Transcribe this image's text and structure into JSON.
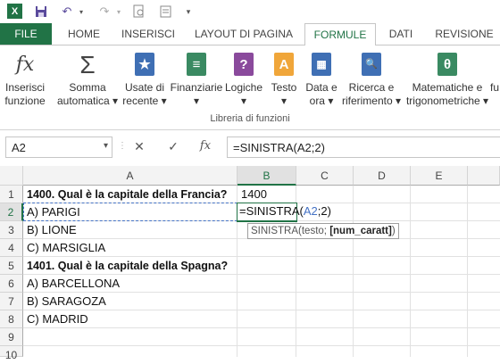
{
  "qat": {
    "app_icon": "X",
    "save_icon": "save-icon",
    "undo_icon": "undo-icon",
    "redo_icon": "redo-icon"
  },
  "tabs": [
    {
      "label": "FILE"
    },
    {
      "label": "HOME"
    },
    {
      "label": "INSERISCI"
    },
    {
      "label": "LAYOUT DI PAGINA"
    },
    {
      "label": "FORMULE"
    },
    {
      "label": "DATI"
    },
    {
      "label": "REVISIONE"
    }
  ],
  "ribbon": {
    "buttons": [
      {
        "label": "Inserisci\nfunzione",
        "line1": "Inserisci",
        "line2": "funzione",
        "icon": "fx"
      },
      {
        "line1": "Somma",
        "line2": "automatica ▾",
        "icon": "Σ"
      },
      {
        "line1": "Usate di",
        "line2": "recente ▾",
        "icon": "★"
      },
      {
        "line1": "Finanziarie",
        "line2": "▾",
        "icon": "≡"
      },
      {
        "line1": "Logiche",
        "line2": "▾",
        "icon": "?"
      },
      {
        "line1": "Testo",
        "line2": "▾",
        "icon": "A"
      },
      {
        "line1": "Data e",
        "line2": "ora ▾",
        "icon": "▦"
      },
      {
        "line1": "Ricerca e",
        "line2": "riferimento ▾",
        "icon": "🔍"
      },
      {
        "line1": "Matematiche e",
        "line2": "trigonometriche ▾",
        "icon": "θ"
      },
      {
        "line1": "",
        "line2": "fu",
        "icon": ""
      }
    ],
    "group_label": "Libreria di funzioni"
  },
  "formula_bar": {
    "name_box": "A2",
    "cancel": "✕",
    "confirm": "✓",
    "fx": "fx",
    "formula": "=SINISTRA(A2;2)"
  },
  "grid": {
    "columns": [
      "A",
      "B",
      "C",
      "D",
      "E"
    ],
    "rows": [
      "1",
      "2",
      "3",
      "4",
      "5",
      "6",
      "7",
      "8",
      "9",
      "10"
    ],
    "cells": {
      "A1": "1400. Qual è la capitale della Francia?",
      "B1": "1400",
      "A2": "A) PARIGI",
      "A3": "B) LIONE",
      "A4": "C) MARSIGLIA",
      "A5": "1401. Qual è la capitale della Spagna?",
      "A6": "A) BARCELLONA",
      "A7": "B) SARAGOZA",
      "A8": "C) MADRID"
    },
    "edit_cell": {
      "prefix": "=SINISTRA(",
      "ref": "A2",
      "suffix": ";2)"
    },
    "tooltip": {
      "func": "SINISTRA(testo; ",
      "arg": "[num_caratt]",
      "end": ")"
    }
  }
}
